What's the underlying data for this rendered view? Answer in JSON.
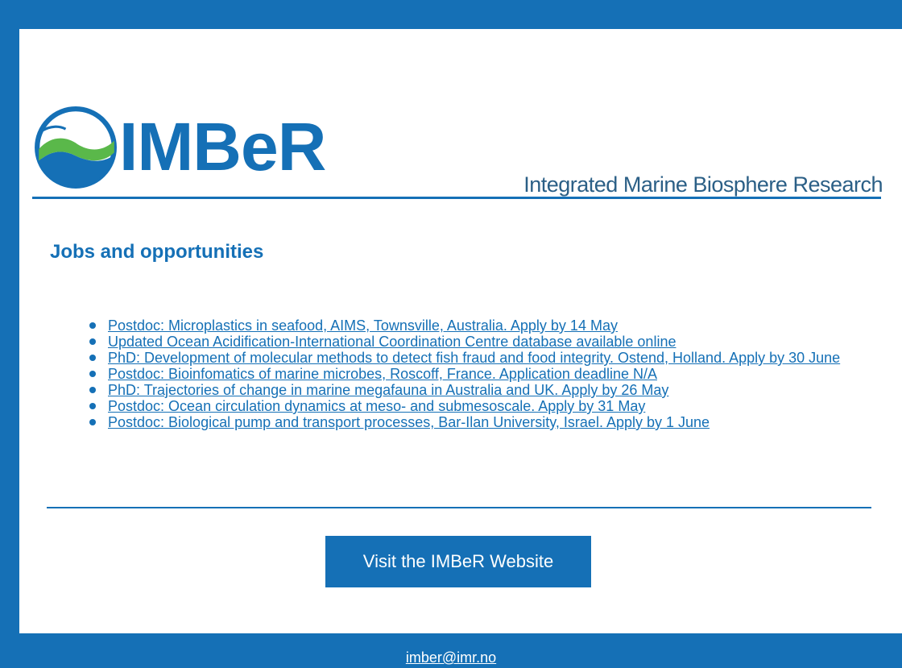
{
  "colors": {
    "brand_blue": "#1570b6",
    "tagline_blue": "#2b5f86",
    "logo_green": "#5ab84a",
    "background": "#ffffff"
  },
  "header": {
    "logo_text": "IMBeR",
    "tagline": "Integrated Marine Biosphere Research"
  },
  "main": {
    "section_title": "Jobs and opportunities",
    "jobs": [
      {
        "label": "Postdoc: Microplastics in seafood, AIMS, Townsville, Australia. Apply by 14 May"
      },
      {
        "label": "Updated Ocean Acidification-International Coordination Centre database available online"
      },
      {
        "label": "PhD: Development of molecular methods to detect fish fraud and food integrity. Ostend, Holland. Apply by 30 June"
      },
      {
        "label": "Postdoc: Bioinfomatics of marine microbes, Roscoff, France. Application deadline N/A"
      },
      {
        "label": "PhD: Trajectories of change in marine megafauna in Australia and UK. Apply by 26 May"
      },
      {
        "label": "Postdoc: Ocean circulation dynamics at meso- and submesoscale. Apply by 31 May"
      },
      {
        "label": "Postdoc: Biological pump and transport processes, Bar-Ilan University, Israel. Apply by 1 June"
      }
    ],
    "cta_label": "Visit the IMBeR Website"
  },
  "footer": {
    "email": "imber@imr.no"
  }
}
